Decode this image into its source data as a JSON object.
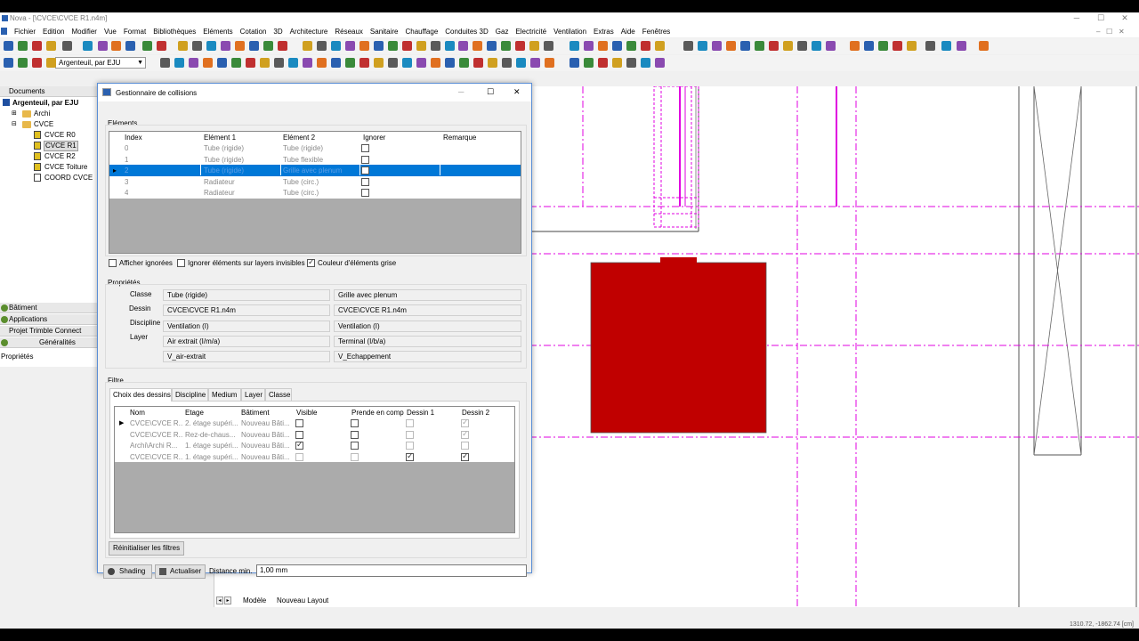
{
  "app": {
    "title": "Nova - [\\CVCE\\CVCE R1.n4m]",
    "controls": {
      "min": "─",
      "max": "☐",
      "close": "✕"
    }
  },
  "menu": [
    "Fichier",
    "Edition",
    "Modifier",
    "Vue",
    "Format",
    "Bibliothèques",
    "Eléments",
    "Cotation",
    "3D",
    "Architecture",
    "Réseaux",
    "Sanitaire",
    "Chauffage",
    "Conduites 3D",
    "Gaz",
    "Electricité",
    "Ventilation",
    "Extras",
    "Aide",
    "Fenêtres"
  ],
  "toolbar": {
    "project_select": "Argenteuil, par EJU"
  },
  "left_panel": {
    "documents_label": "Documents",
    "root": "Argenteuil, par EJU",
    "folders": [
      "Archi",
      "CVCE"
    ],
    "files": [
      "CVCE R0",
      "CVCE R1",
      "CVCE R2",
      "CVCE Toiture",
      "COORD CVCE"
    ],
    "panels": [
      "Bâtiment",
      "Applications",
      "Projet Trimble Connect",
      "Généralités",
      "Propriétés"
    ]
  },
  "dialog": {
    "title": "Gestionnaire de collisions",
    "elements_label": "Eléments",
    "columns": [
      "Index",
      "Elément 1",
      "Elément 2",
      "Ignorer",
      "Remarque"
    ],
    "rows": [
      {
        "index": "0",
        "e1": "Tube (rigide)",
        "e2": "Tube (rigide)"
      },
      {
        "index": "1",
        "e1": "Tube (rigide)",
        "e2": "Tube flexible"
      },
      {
        "index": "2",
        "e1": "Tube (rigide)",
        "e2": "Grille avec plenum"
      },
      {
        "index": "3",
        "e1": "Radiateur",
        "e2": "Tube (circ.)"
      },
      {
        "index": "4",
        "e1": "Radiateur",
        "e2": "Tube (circ.)"
      }
    ],
    "opt_show_ignored": "Afficher ignorées",
    "opt_ignore_invisible": "Ignorer éléments sur layers invisibles",
    "opt_grey": "Couleur d'éléments grise",
    "props_label": "Propriétés",
    "props": {
      "labels": [
        "Classe",
        "Dessin",
        "Discipline",
        "Layer"
      ],
      "left": [
        "Tube (rigide)",
        "CVCE\\CVCE R1.n4m",
        "Ventilation (I)",
        "Air extrait (I/m/a)",
        "V_air-extrait"
      ],
      "right": [
        "Grille avec plenum",
        "CVCE\\CVCE R1.n4m",
        "Ventilation (I)",
        "Terminal (I/b/a)",
        "V_Echappement"
      ]
    },
    "filter_label": "Filtre",
    "tabs": [
      "Choix des dessins",
      "Discipline",
      "Medium",
      "Layer",
      "Classe"
    ],
    "filter_columns": [
      "Nom",
      "Etage",
      "Bâtiment",
      "Visible",
      "Prende en comp",
      "Dessin 1",
      "Dessin 2"
    ],
    "filter_rows": [
      {
        "nom": "CVCE\\CVCE R...",
        "etage": "2. étage supéri...",
        "bat": "Nouveau Bâti..."
      },
      {
        "nom": "CVCE\\CVCE R...",
        "etage": "Rez-de-chaus...",
        "bat": "Nouveau Bâti..."
      },
      {
        "nom": "Archi\\Archi R...",
        "etage": "1. étage supéri...",
        "bat": "Nouveau Bâti..."
      },
      {
        "nom": "CVCE\\CVCE R...",
        "etage": "1. étage supéri...",
        "bat": "Nouveau Bâti..."
      }
    ],
    "reset_filters": "Réinitialiser les filtres",
    "shading": "Shading",
    "update": "Actualiser",
    "distance_label": "Distance min.",
    "distance_value": "1,00 mm"
  },
  "canvas": {
    "tabs": [
      "Modèle",
      "Nouveau Layout"
    ]
  },
  "status": {
    "coords": "1310.72, -1862.74 [cm]"
  },
  "colors": {
    "accent": "#0078d7",
    "magenta": "#e000e0",
    "red": "#c00000"
  }
}
